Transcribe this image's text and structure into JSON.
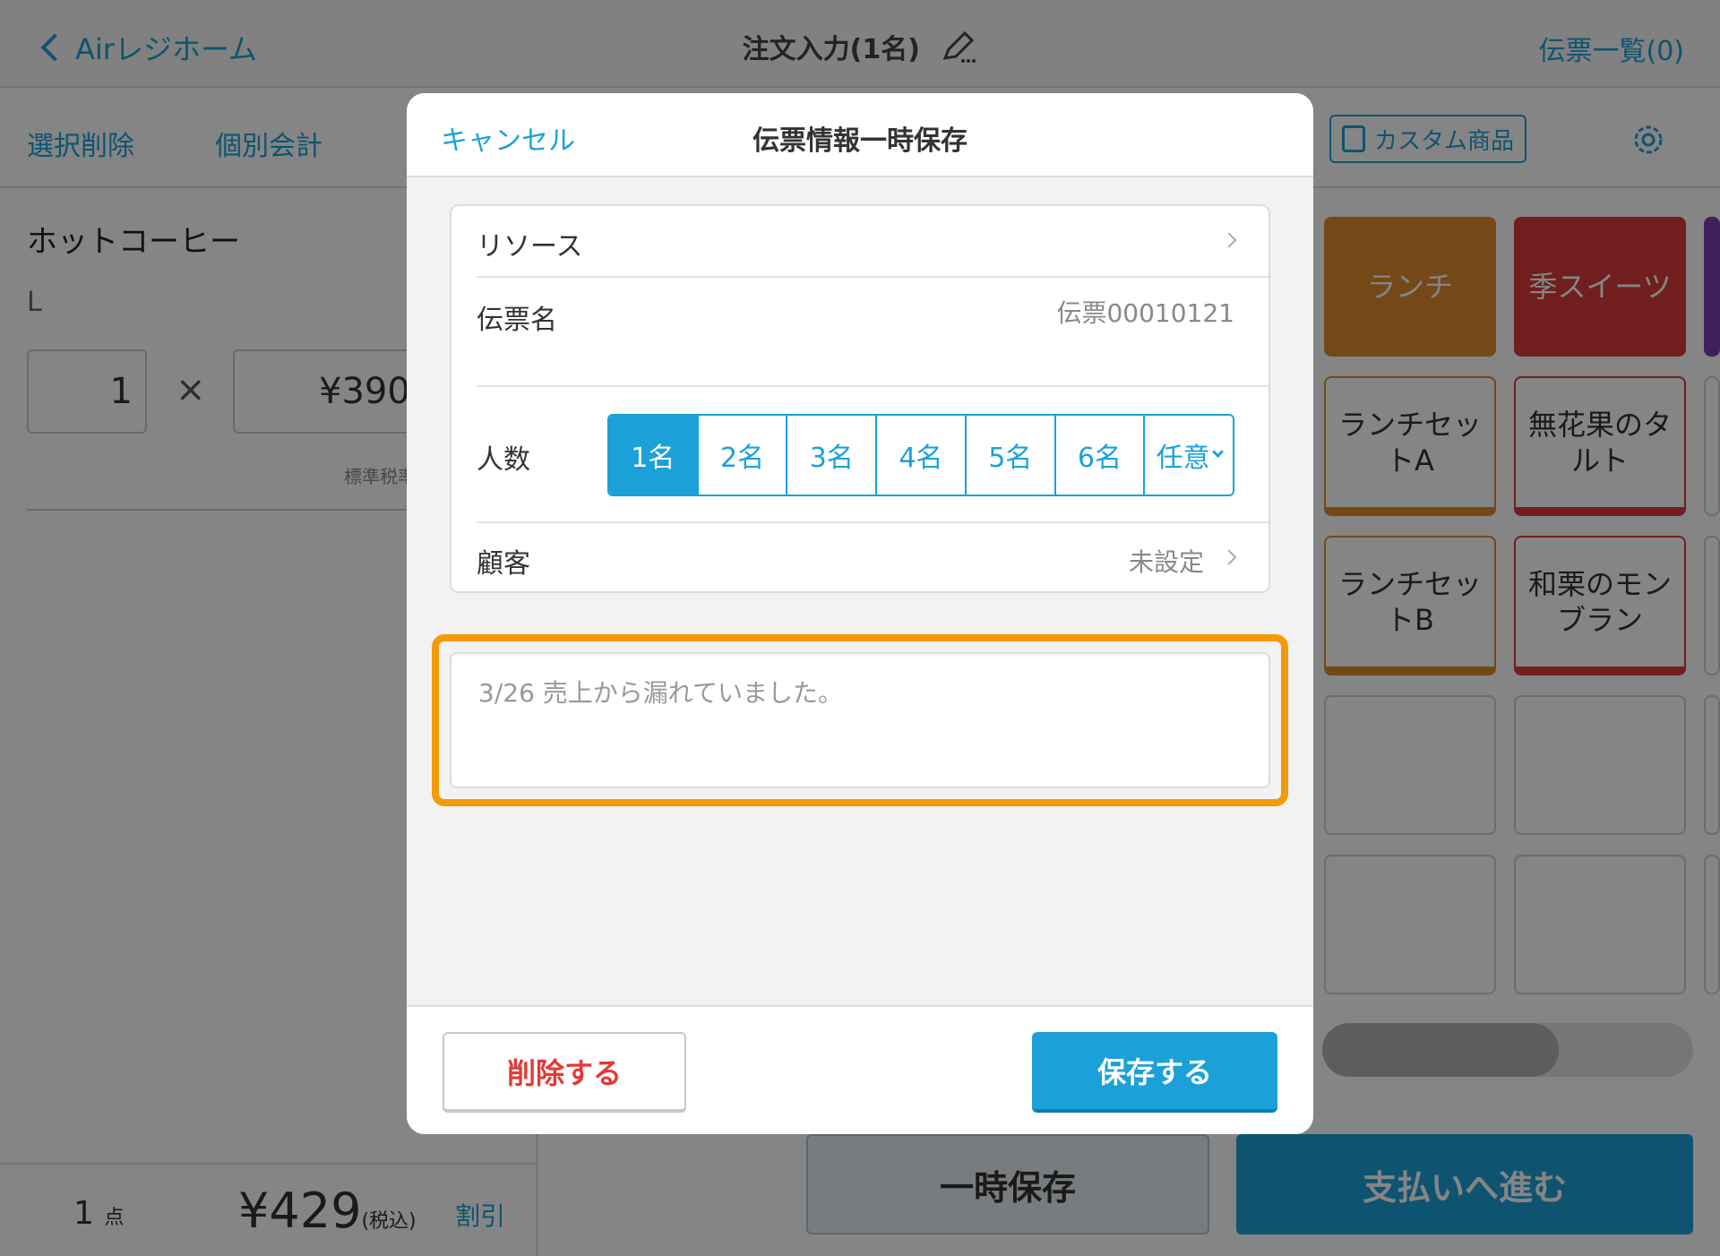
{
  "header": {
    "back_label": "Airレジホーム",
    "title": "注文入力(1名)",
    "slip_list": "伝票一覧(0)"
  },
  "toolbar": {
    "select_delete": "選択削除",
    "separate_bill": "個別会計",
    "custom_item": "カスタム商品"
  },
  "order": {
    "item_name": "ホットコーヒー",
    "item_size": "L",
    "quantity": "1",
    "times": "×",
    "unit_price": "¥390",
    "tax_note": "標準税率",
    "count": "1",
    "count_unit": "点",
    "total": "¥429",
    "tax_incl": "(税込)",
    "discount": "割引"
  },
  "menu": {
    "categories": [
      "ランチ",
      "季スイーツ"
    ],
    "items": [
      "ランチセットA",
      "無花果のタルト",
      "ランチセットB",
      "和栗のモンブラン"
    ]
  },
  "bottom": {
    "hold_label": "一時保存",
    "pay_label": "支払いへ進む"
  },
  "modal": {
    "cancel_label": "キャンセル",
    "title": "伝票情報一時保存",
    "resource_label": "リソース",
    "slip_name_label": "伝票名",
    "slip_name_value": "伝票00010121",
    "people_label": "人数",
    "people_options": [
      "1名",
      "2名",
      "3名",
      "4名",
      "5名",
      "6名",
      "任意"
    ],
    "people_selected": "1名",
    "customer_label": "顧客",
    "customer_value": "未設定",
    "memo_text": "3/26 売上から漏れていました。",
    "delete_label": "削除する",
    "save_label": "保存する"
  },
  "colors": {
    "accent": "#1ba1d8",
    "highlight": "#f49a08",
    "danger": "#e53935",
    "lunch_category": "#e08a2e",
    "sweets_category": "#d83a3a",
    "purple_category": "#7b3fb0"
  }
}
